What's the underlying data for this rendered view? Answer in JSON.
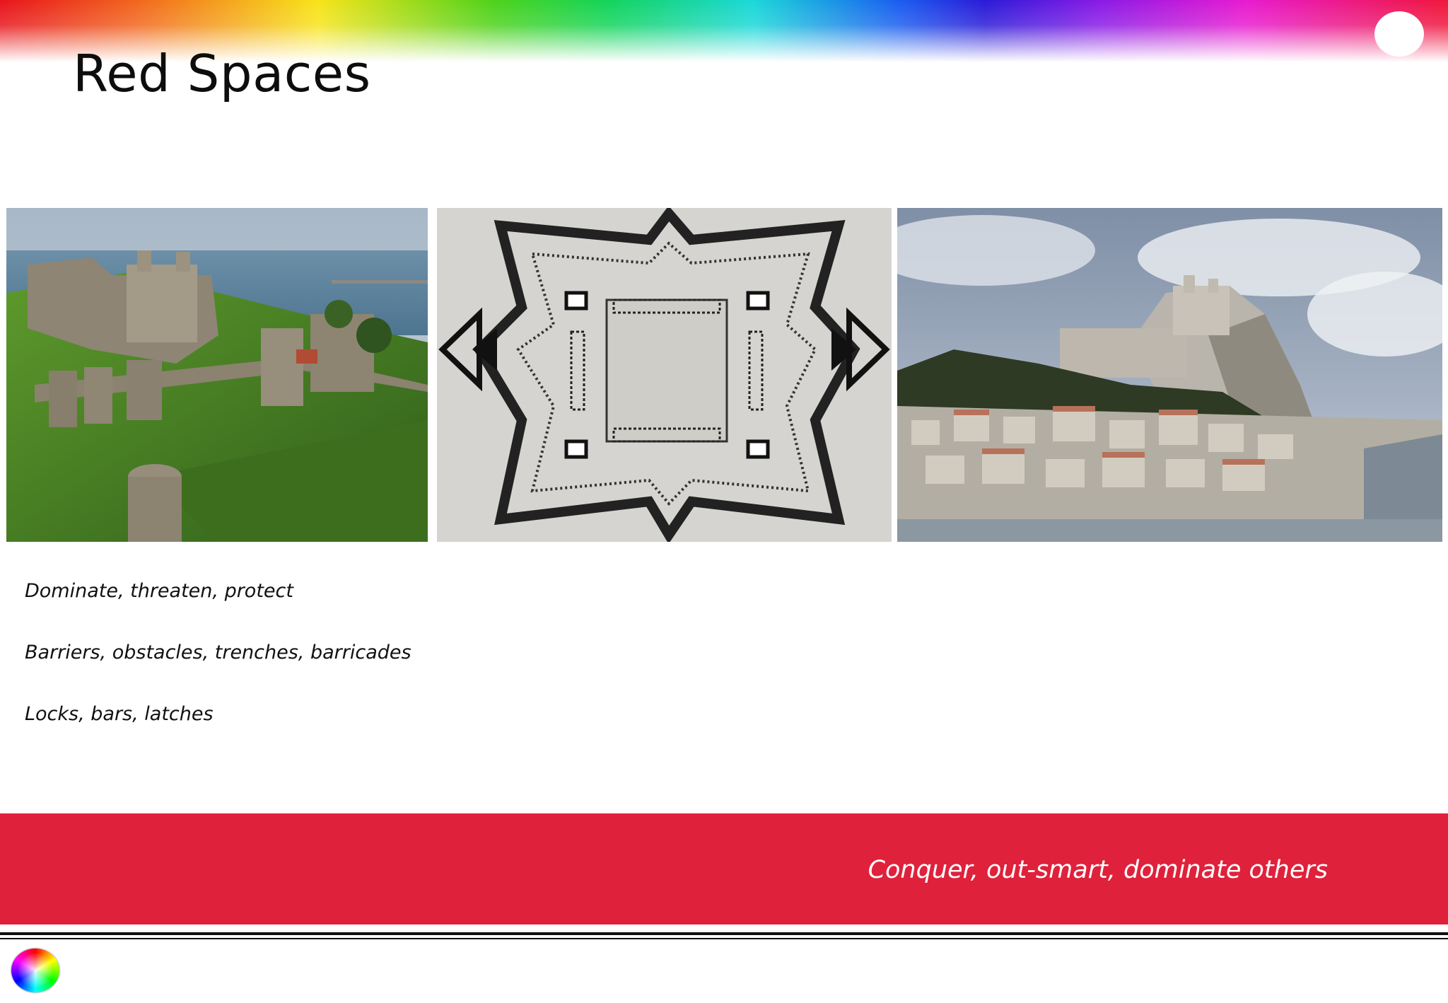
{
  "slide": {
    "title": "Red Spaces",
    "bullets": [
      "Dominate, threaten, protect",
      "Barriers, obstacles, trenches, barricades",
      "Locks, bars, latches"
    ],
    "banner_text": "Conquer, out-smart, dominate others"
  },
  "images": [
    {
      "name": "castle-on-cliff-photo"
    },
    {
      "name": "star-fort-plan-drawing"
    },
    {
      "name": "hilltop-citadel-town-photo"
    }
  ],
  "colors": {
    "banner": "#e0213b",
    "title": "#0d0d0d",
    "banner_text": "#ffffff"
  }
}
